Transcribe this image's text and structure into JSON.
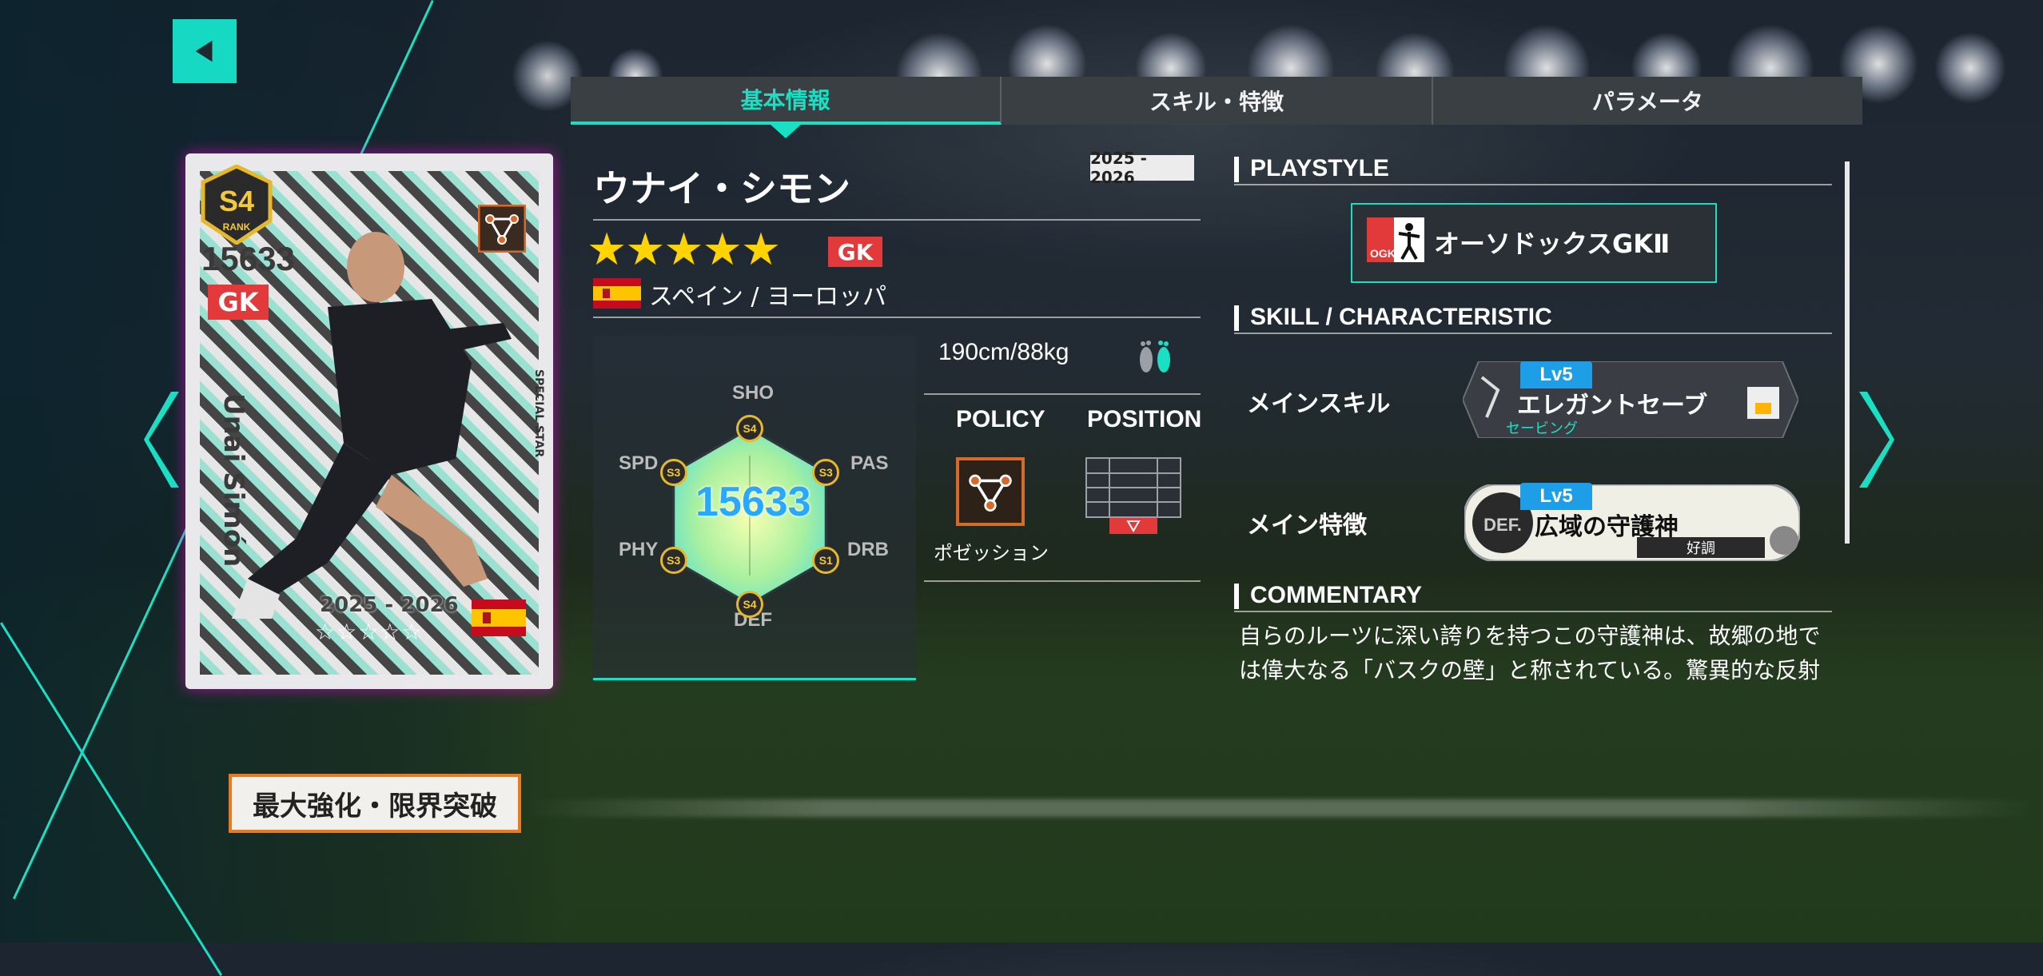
{
  "tabs": [
    {
      "label": "基本情報",
      "active": true
    },
    {
      "label": "スキル・特徴",
      "active": false
    },
    {
      "label": "パラメータ",
      "active": false
    }
  ],
  "card": {
    "rank": "S4",
    "rank_sub": "RANK",
    "rating": "15633",
    "position": "GK",
    "name": "Unai Simón",
    "season": "2025 - 2026",
    "stars": "☆☆☆☆☆",
    "special": "SPECIAL STAR",
    "flag_country": "Spain"
  },
  "max_button": "最大強化・限界突破",
  "player": {
    "name": "ウナイ・シモン",
    "season": "2025 - 2026",
    "stars": "★★★★★",
    "position": "GK",
    "nation": "スペイン / ヨーロッパ",
    "height_weight": "190cm/88kg"
  },
  "radar": {
    "total": "15633",
    "stats": [
      {
        "label": "SHO",
        "grade": "S4"
      },
      {
        "label": "PAS",
        "grade": "S3"
      },
      {
        "label": "DRB",
        "grade": "S1"
      },
      {
        "label": "DEF",
        "grade": "S4"
      },
      {
        "label": "PHY",
        "grade": "S3"
      },
      {
        "label": "SPD",
        "grade": "S3"
      }
    ],
    "grade_level": [
      4,
      3,
      1,
      4,
      3,
      3
    ]
  },
  "policy": {
    "header": "POLICY",
    "label": "ポゼッション"
  },
  "position_panel": {
    "header": "POSITION"
  },
  "playstyle": {
    "header": "PLAYSTYLE",
    "badge": "OGK",
    "label": "オーソドックスGKⅡ"
  },
  "skill": {
    "header": "SKILL / CHARACTERISTIC",
    "main_skill_label": "メインスキル",
    "main_skill": {
      "level": "Lv5",
      "name": "エレガントセーブ",
      "sub": "セービング"
    },
    "main_trait_label": "メイン特徴",
    "main_trait": {
      "level": "Lv5",
      "badge": "DEF.",
      "name": "広域の守護神",
      "condition": "好調"
    }
  },
  "commentary": {
    "header": "COMMENTARY",
    "line1": "自らのルーツに深い誇りを持つこの守護神は、故郷の地で",
    "line2": "は偉大なる「バスクの壁」と称されている。驚異的な反射"
  },
  "colors": {
    "accent": "#19e0c4",
    "gk_red": "#e23a3a",
    "policy_orange": "#d66a2a",
    "star_gold": "#ffd400",
    "rating_blue": "#29a8ff"
  }
}
